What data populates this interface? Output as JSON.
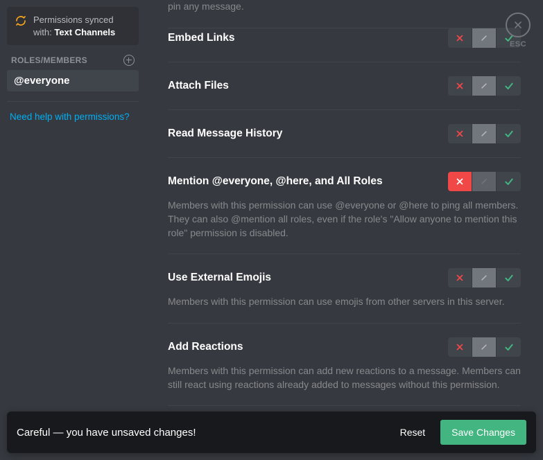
{
  "sidebar": {
    "sync_prefix": "Permissions synced with: ",
    "sync_target": "Text Channels",
    "section_label": "ROLES/MEMBERS",
    "roles": [
      {
        "name": "@everyone"
      }
    ],
    "help_link": "Need help with permissions?"
  },
  "close": {
    "esc_label": "ESC"
  },
  "permissions_cutoff_top": "pin any message.",
  "permissions": [
    {
      "key": "embed_links",
      "title": "Embed Links",
      "description": "",
      "state": "neutral"
    },
    {
      "key": "attach_files",
      "title": "Attach Files",
      "description": "",
      "state": "neutral"
    },
    {
      "key": "read_message_history",
      "title": "Read Message History",
      "description": "",
      "state": "neutral"
    },
    {
      "key": "mention_everyone",
      "title": "Mention @everyone, @here, and All Roles",
      "description": "Members with this permission can use @everyone or @here to ping all members. They can also @mention all roles, even if the role's \"Allow anyone to mention this role\" permission is disabled.",
      "state": "deny"
    },
    {
      "key": "use_external_emojis",
      "title": "Use External Emojis",
      "description": "Members with this permission can use emojis from other servers in this server.",
      "state": "neutral"
    },
    {
      "key": "add_reactions",
      "title": "Add Reactions",
      "description": "Members with this permission can add new reactions to a message. Members can still react using reactions already added to messages without this permission.",
      "state": "neutral"
    }
  ],
  "unsaved": {
    "message": "Careful — you have unsaved changes!",
    "reset_label": "Reset",
    "save_label": "Save Changes"
  },
  "colors": {
    "deny": "#f04747",
    "neutral": "#72767d",
    "allow": "#43b581",
    "link": "#00aff4",
    "sync_icon": "#faa61a"
  }
}
